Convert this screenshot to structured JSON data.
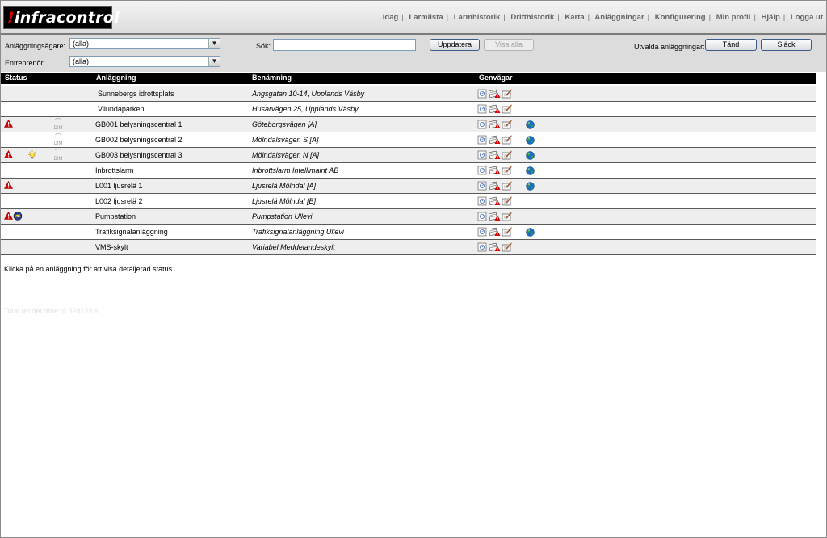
{
  "app": {
    "logo_text": "infracontrol",
    "logo_dot": "!"
  },
  "nav": [
    "Idag",
    "Larmlista",
    "Larmhistorik",
    "Drifthistorik",
    "Karta",
    "Anläggningar",
    "Konfigurering",
    "Min profil",
    "Hjälp",
    "Logga ut"
  ],
  "filters": {
    "owner_label": "Anläggningsägare:",
    "owner_value": "(alla)",
    "contractor_label": "Entreprenör:",
    "contractor_value": "(alla)",
    "search_label": "Sök:",
    "search_value": "",
    "update_label": "Uppdatera",
    "show_all_label": "Visa alla",
    "selected_label": "Utvalda anläggningar:",
    "on_label": "Tänd",
    "off_label": "Släck"
  },
  "table": {
    "headers": {
      "status": "Status",
      "facility": "Anläggning",
      "name": "Benämning",
      "shortcuts": "Genvägar"
    },
    "dim_label": "DIM",
    "rows": [
      {
        "facility": "Sunnebergs idrottsplats",
        "name": "Ängsgatan 10-14, Upplands Väsby",
        "alarm": false,
        "lamp": false,
        "gauge": false,
        "dim": false,
        "globe": false,
        "indent": true
      },
      {
        "facility": "Vilundaparken",
        "name": "Husarvägen 25, Upplands Väsby",
        "alarm": false,
        "lamp": false,
        "gauge": false,
        "dim": false,
        "globe": false,
        "indent": true
      },
      {
        "facility": "GB001 belysningscentral 1",
        "name": "Göteborgsvägen [A]",
        "alarm": true,
        "lamp": false,
        "gauge": false,
        "dim": true,
        "globe": true,
        "indent": false
      },
      {
        "facility": "GB002 belysningscentral 2",
        "name": "Mölndalsvägen S [A]",
        "alarm": false,
        "lamp": false,
        "gauge": false,
        "dim": true,
        "globe": true,
        "indent": false
      },
      {
        "facility": "GB003 belysningscentral 3",
        "name": "Mölndalsvägen N [A]",
        "alarm": true,
        "lamp": true,
        "gauge": false,
        "dim": true,
        "globe": true,
        "indent": false
      },
      {
        "facility": "Inbrottslarm",
        "name": "Inbrottslarm Intellimaint AB",
        "alarm": false,
        "lamp": false,
        "gauge": false,
        "dim": false,
        "globe": true,
        "indent": false
      },
      {
        "facility": "L001 ljusrelä 1",
        "name": "Ljusrelä Mölndal [A]",
        "alarm": true,
        "lamp": false,
        "gauge": false,
        "dim": false,
        "globe": true,
        "indent": false
      },
      {
        "facility": "L002 ljusrelä 2",
        "name": "Ljusrelä Mölndal [B]",
        "alarm": false,
        "lamp": false,
        "gauge": false,
        "dim": false,
        "globe": false,
        "indent": false
      },
      {
        "facility": "Pumpstation",
        "name": "Pumpstation Ullevi",
        "alarm": true,
        "lamp": false,
        "gauge": true,
        "dim": false,
        "globe": false,
        "indent": false
      },
      {
        "facility": "Trafiksignalanläggning",
        "name": "Trafiksignalanläggning Ullevi",
        "alarm": false,
        "lamp": false,
        "gauge": false,
        "dim": false,
        "globe": true,
        "indent": false
      },
      {
        "facility": "VMS-skylt",
        "name": "Variabel Meddelandeskylt",
        "alarm": false,
        "lamp": false,
        "gauge": false,
        "dim": false,
        "globe": false,
        "indent": false
      }
    ]
  },
  "hint": "Klicka på en anläggning för att visa detaljerad status",
  "render_time": "Total render time: 0.328125 s",
  "colors": {
    "alarm": "#d40000",
    "header_bg": "#000000",
    "row_alt": "#eeeeee",
    "filter_bg": "#dcdcdc"
  }
}
